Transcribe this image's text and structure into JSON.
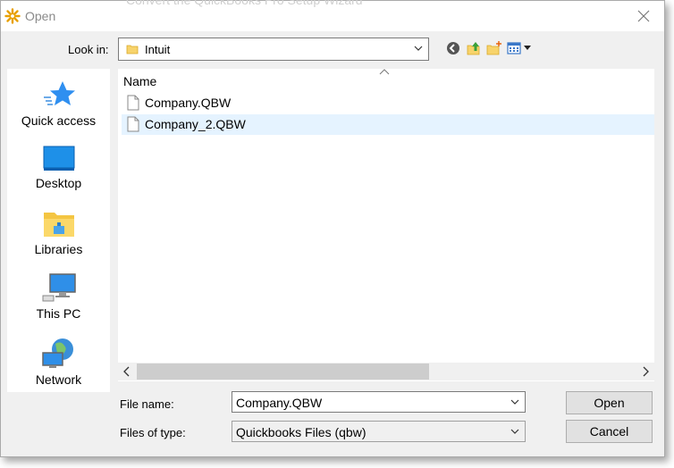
{
  "window": {
    "title": "Open",
    "background_hint": "Convert the QuickBooks Pro Setup Wizard"
  },
  "look_in": {
    "label": "Look in:",
    "value": "Intuit"
  },
  "places": [
    {
      "label": "Quick access",
      "icon": "star-icon"
    },
    {
      "label": "Desktop",
      "icon": "desktop-icon"
    },
    {
      "label": "Libraries",
      "icon": "libraries-icon"
    },
    {
      "label": "This PC",
      "icon": "computer-icon"
    },
    {
      "label": "Network",
      "icon": "network-icon"
    }
  ],
  "file_list": {
    "column_header": "Name",
    "files": [
      {
        "name": "Company.QBW",
        "selected": false
      },
      {
        "name": "Company_2.QBW",
        "selected": true
      }
    ]
  },
  "file_name": {
    "label": "File name:",
    "value": "Company.QBW"
  },
  "file_type": {
    "label": "Files of type:",
    "value": "Quickbooks Files (qbw)"
  },
  "buttons": {
    "open": "Open",
    "cancel": "Cancel"
  },
  "colors": {
    "selection": "#e5f3ff",
    "accent": "#0078d7"
  }
}
